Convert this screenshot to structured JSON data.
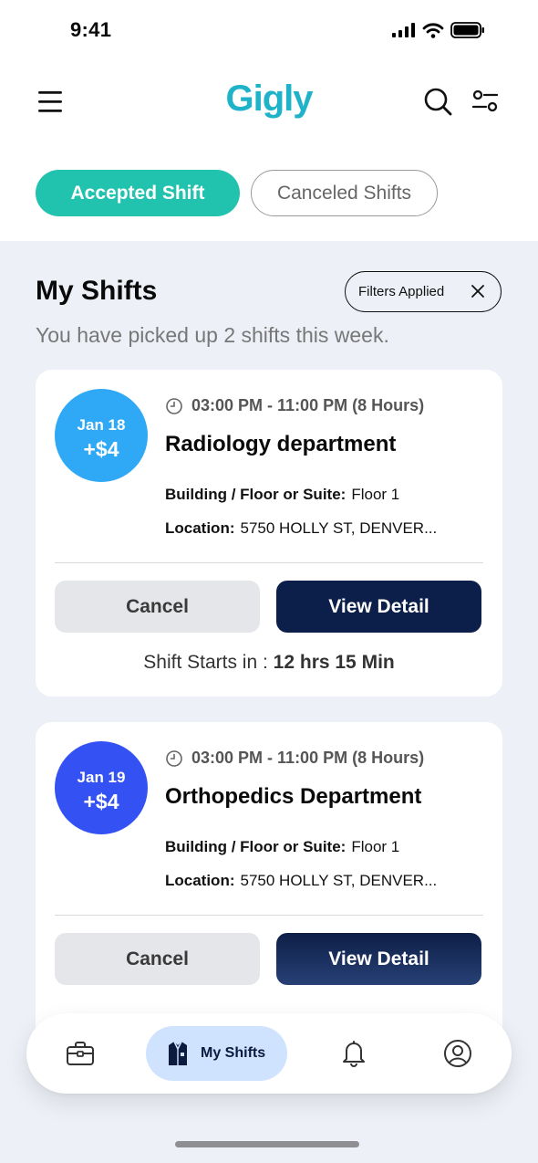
{
  "status_bar": {
    "time": "9:41"
  },
  "header": {
    "app_name": "Gigly"
  },
  "tabs": [
    {
      "label": "Accepted Shift",
      "active": true
    },
    {
      "label": "Canceled Shifts",
      "active": false
    }
  ],
  "section": {
    "title": "My Shifts",
    "filter_chip": "Filters Applied",
    "subtitle": "You have picked up 2 shifts this week."
  },
  "shifts": [
    {
      "date": "Jan 18",
      "amount": "+$4",
      "time": "03:00 PM - 11:00 PM (8 Hours)",
      "department": "Radiology department",
      "building_label": "Building / Floor or Suite:",
      "building_value": "Floor 1",
      "location_label": "Location:",
      "location_value": "5750 HOLLY ST, DENVER...",
      "cancel_label": "Cancel",
      "view_label": "View Detail",
      "starts_label": "Shift Starts in :",
      "starts_value": "12 hrs 15 Min",
      "circle_color": "#2fa8f6"
    },
    {
      "date": "Jan 19",
      "amount": "+$4",
      "time": "03:00 PM - 11:00 PM (8 Hours)",
      "department": "Orthopedics Department",
      "building_label": "Building / Floor or Suite:",
      "building_value": "Floor 1",
      "location_label": "Location:",
      "location_value": "5750 HOLLY ST, DENVER...",
      "cancel_label": "Cancel",
      "view_label": "View Detail",
      "circle_color": "#3452f4"
    }
  ],
  "bottom_nav": {
    "items": [
      {
        "icon": "briefcase-icon"
      },
      {
        "icon": "shirt-icon",
        "label": "My Shifts",
        "active": true
      },
      {
        "icon": "bell-icon"
      },
      {
        "icon": "profile-icon"
      }
    ]
  },
  "colors": {
    "brand": "#1fb3c9",
    "accent": "#22c3ae",
    "primary_button": "#0b1f4a",
    "background": "#edf1f7",
    "nav_active": "#cfe3ff"
  }
}
